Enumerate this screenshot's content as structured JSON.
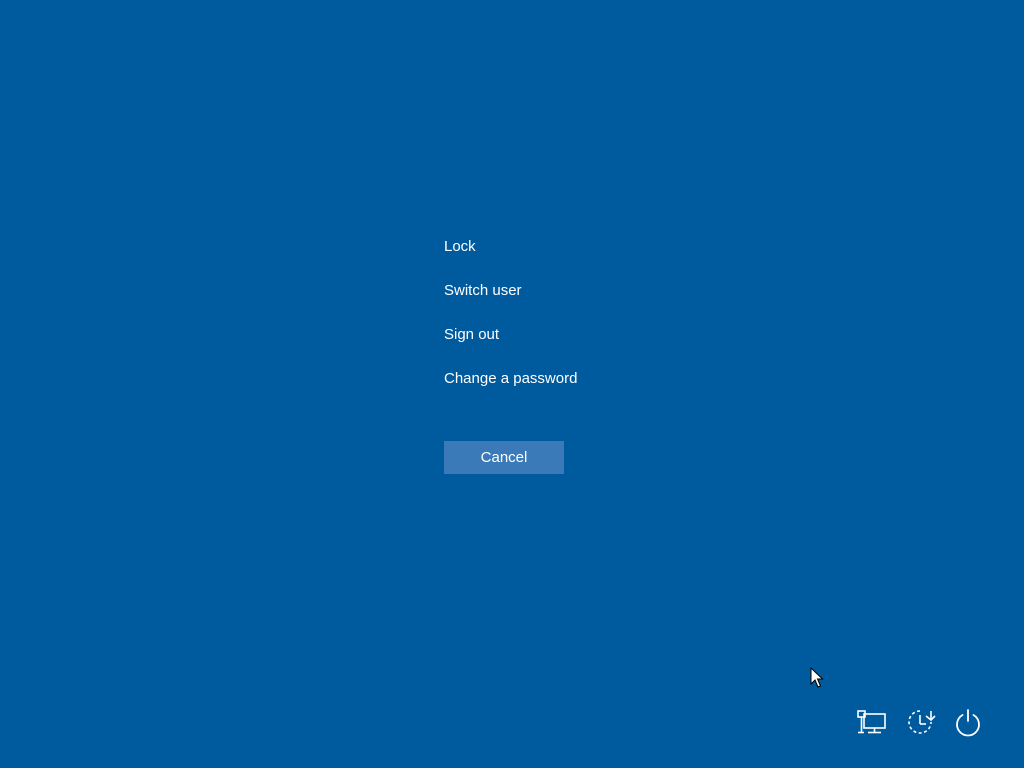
{
  "menu": {
    "items": [
      {
        "label": "Lock"
      },
      {
        "label": "Switch user"
      },
      {
        "label": "Sign out"
      },
      {
        "label": "Change a password"
      }
    ]
  },
  "cancel_label": "Cancel",
  "tray": {
    "network": {
      "icon": "network-icon"
    },
    "ease_of_access": {
      "icon": "ease-of-access-icon"
    },
    "power": {
      "icon": "power-icon"
    }
  },
  "colors": {
    "background": "#005a9e",
    "button": "#3a7ab8",
    "text": "#ffffff"
  }
}
